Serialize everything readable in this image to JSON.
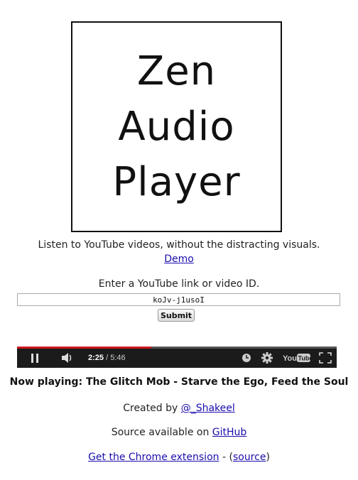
{
  "logo": {
    "lines": [
      "Zen",
      "Audio",
      "Player"
    ]
  },
  "tagline": "Listen to YouTube videos, without the distracting visuals.",
  "demo_link": "Demo",
  "input": {
    "prompt": "Enter a YouTube link or video ID.",
    "value": "koJv-j1usoI"
  },
  "submit_label": "Submit",
  "player": {
    "current_time": "2:25",
    "separator": "/",
    "duration": "5:46",
    "progress": 0.419,
    "progress_color": "#cc181e",
    "icons": [
      "pause-icon",
      "volume-icon",
      "watch-later-icon",
      "settings-gear-icon",
      "youtube-logo-icon",
      "fullscreen-icon"
    ]
  },
  "now_playing": "Now playing: The Glitch Mob - Starve the Ego, Feed the Soul",
  "credit": {
    "prefix": "Created by",
    "link": "@_Shakeel"
  },
  "source": {
    "prefix": "Source available on",
    "link": "GitHub"
  },
  "extension": {
    "link": "Get the Chrome extension",
    "separator": "-",
    "open_paren": "(",
    "source_link": "source",
    "close_paren": ")"
  }
}
